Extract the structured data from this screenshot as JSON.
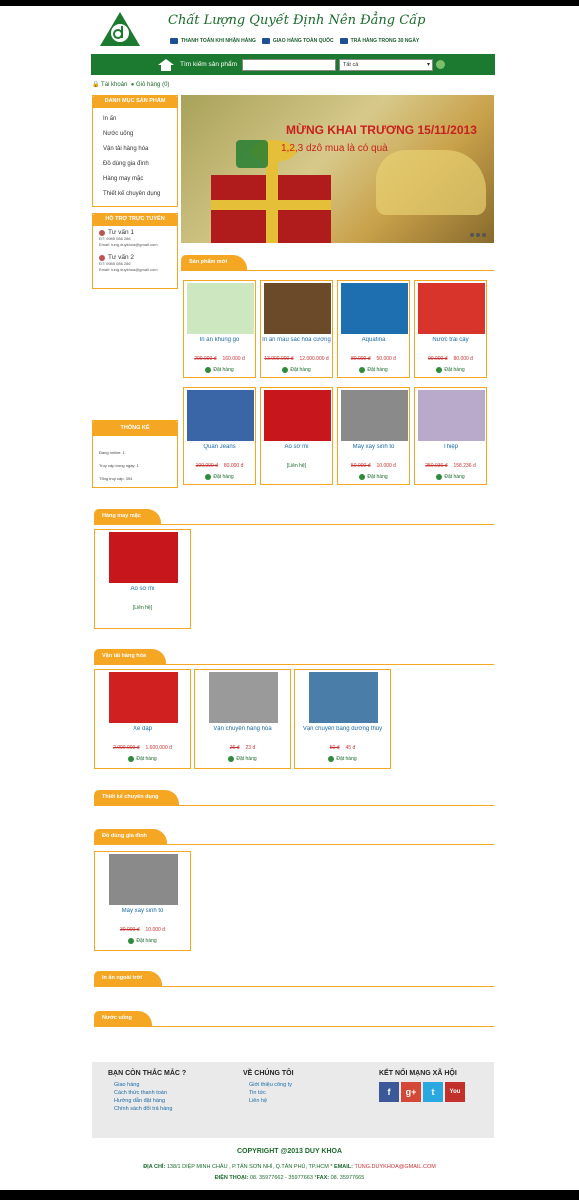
{
  "header": {
    "slogan": "Chất Lượng Quyết Định Nên Đẳng Cấp",
    "promos": [
      "THANH TOÁN KHI NHẬN HÀNG",
      "GIAO HÀNG TOÀN QUỐC",
      "TRẢ HÀNG TRONG 30 NGÀY"
    ]
  },
  "search": {
    "label": "Tìm kiếm sản phẩm",
    "input_value": "",
    "category_selected": "Tất cả"
  },
  "account": {
    "account_label": "Tài khoản",
    "cart_label": "Giỏ hàng (0)"
  },
  "sidebar": {
    "categories_title": "DANH MỤC SẢN PHẨM",
    "categories": [
      "In ấn",
      "Nước uống",
      "Vận tải hàng hóa",
      "Đồ dùng gia đình",
      "Hàng may mặc",
      "Thiết kế chuyên dụng"
    ],
    "support_title": "HỖ TRỢ TRỰC TUYẾN",
    "support": [
      {
        "name": "Tư vấn 1",
        "phone": "ĐT: 0985 086 286",
        "email": "Email: tung.duykhoa@gmail.com"
      },
      {
        "name": "Tư vấn 2",
        "phone": "ĐT: 0985 086 286",
        "email": "Email: tung.duykhoa@gmail.com"
      }
    ],
    "stats_title": "THỐNG KÊ",
    "stats": [
      "Đang online: 1",
      "Truy cập trong ngày: 1",
      "Tổng truy cập: 394"
    ]
  },
  "banner": {
    "title": "MỪNG KHAI TRƯƠNG 15/11/2013",
    "subtitle": "1,2,3 dzô mua là có quà"
  },
  "order_label": "Đặt hàng",
  "sections": {
    "new_products": {
      "title": "Sản phẩm mới",
      "items": [
        {
          "name": "In ấn khung gỗ",
          "old": "200.000 đ",
          "new": "160.000 đ",
          "img": "#cde8c0"
        },
        {
          "name": "In ấn mẫu sắc hoa cương",
          "old": "13.000.000 đ",
          "new": "12.000.000 đ",
          "img": "#6b4a2a"
        },
        {
          "name": "Aquafina",
          "old": "80.000 đ",
          "new": "50.000 đ",
          "img": "#1e6fb0"
        },
        {
          "name": "Nước trái cây",
          "old": "90.000 đ",
          "new": "80.000 đ",
          "img": "#d8342c"
        },
        {
          "name": "Quần Jeans",
          "old": "100.000 đ",
          "new": "80.000 đ",
          "img": "#3a66a8"
        },
        {
          "name": "Áo sơ mi",
          "contact": "[Liên hệ]",
          "img": "#c8171c"
        },
        {
          "name": "Máy xay sinh tố",
          "old": "50.000 đ",
          "new": "10.000 đ",
          "img": "#8a8a8a"
        },
        {
          "name": "Thiệp",
          "old": "250.036 đ",
          "new": "158.236 đ",
          "img": "#b9aacb"
        }
      ]
    },
    "garment": {
      "title": "Hàng may mặc",
      "items": [
        {
          "name": "Áo sơ mi",
          "contact": "[Liên hệ]",
          "img": "#c8171c"
        }
      ]
    },
    "transport": {
      "title": "Vận tải hàng hóa",
      "items": [
        {
          "name": "Xe đạp",
          "old": "2.000.000 đ",
          "new": "1.600.000 đ",
          "img": "#d12020"
        },
        {
          "name": "Vận chuyển hàng hóa",
          "old": "26 đ",
          "new": "23 đ",
          "img": "#9a9a9a"
        },
        {
          "name": "Vận chuyển bằng đường thủy",
          "old": "50 đ",
          "new": "45 đ",
          "img": "#4a7ea8"
        }
      ]
    },
    "design": {
      "title": "Thiết kế chuyên dụng"
    },
    "household": {
      "title": "Đồ dùng gia đình",
      "items": [
        {
          "name": "Máy xay sinh tố",
          "old": "30.000 đ",
          "new": "10.000 đ",
          "img": "#8a8a8a"
        }
      ]
    },
    "outdoor": {
      "title": "In ấn ngoài trời"
    },
    "water": {
      "title": "Nước uống"
    }
  },
  "footer": {
    "col1_title": "BẠN CÒN THẮC MẮC ?",
    "col1_links": [
      "Giao hàng",
      "Cách thức thanh toán",
      "Hướng dẫn đặt hàng",
      "Chính sách đổi trả hàng"
    ],
    "col2_title": "VỀ CHÚNG TÔI",
    "col2_links": [
      "Giới thiệu công ty",
      "Tin tức",
      "Liên hệ"
    ],
    "col3_title": "KẾT NỐI MẠNG XÃ HỘI",
    "social": [
      "f",
      "g+",
      "t",
      "You"
    ],
    "copyright": "COPYRIGHT @2013 DUY KHOA",
    "address_label": "ĐỊA CHỈ:",
    "address": "138/1 DIỆP MINH CHÂU , P.TÂN SƠN NHÌ, Q.TÂN PHÚ, TP.HCM",
    "email_label": "EMAIL:",
    "email": "TUNG.DUYKHOA@GMAIL.COM",
    "phone_label": "ĐIỆN THOẠI:",
    "phone": "08. 35977662 - 35977663",
    "fax_label": "FAX:",
    "fax": "08. 35977665"
  }
}
